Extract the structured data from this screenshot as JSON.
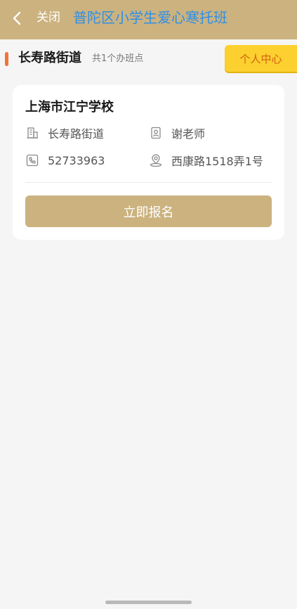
{
  "header": {
    "close_label": "关闭",
    "title": "普陀区小学生爱心寒托班",
    "background": "#cbb27f",
    "title_color": "#2f8fe6"
  },
  "street": {
    "name": "长寿路街道",
    "site_count": "共1个办班点",
    "accent_color": "#f0733a"
  },
  "personal_center": {
    "label": "个人中心",
    "background": "#fcd02e",
    "text_color": "#d45f13"
  },
  "site": {
    "school_name": "上海市江宁学校",
    "street": "长寿路街道",
    "teacher": "谢老师",
    "phone": "52733963",
    "address": "西康路1518弄1号",
    "signup_label": "立即报名",
    "icons": {
      "street": "building-icon",
      "teacher": "contact-card-icon",
      "phone": "phone-icon",
      "address": "location-pin-icon"
    }
  }
}
